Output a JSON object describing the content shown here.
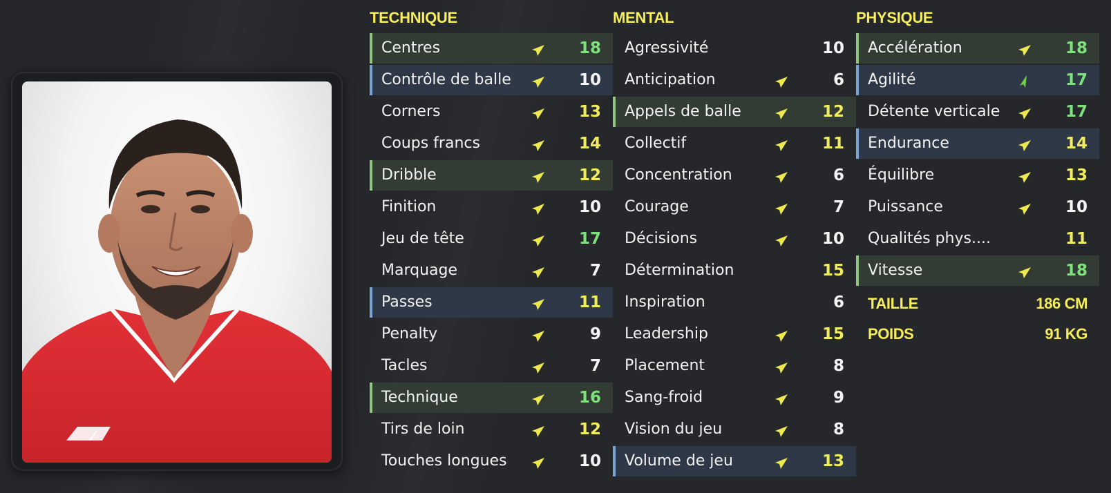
{
  "colors": {
    "background": "#25272b",
    "accent_yellow": "#f5ee5a",
    "value_green": "#7ee27c",
    "value_white": "#f4f4f4",
    "highlight_green": "#8ec77c",
    "highlight_blue": "#79a4da"
  },
  "columns": [
    {
      "title": "TECHNIQUE",
      "rows": [
        {
          "label": "Centres",
          "value": "18",
          "color": "green",
          "highlight": "green",
          "arrow": "yellow-up-right"
        },
        {
          "label": "Contrôle de balle",
          "value": "10",
          "color": "white",
          "highlight": "blue",
          "arrow": "yellow-up-right"
        },
        {
          "label": "Corners",
          "value": "13",
          "color": "yellow",
          "highlight": "none",
          "arrow": "yellow-up-right"
        },
        {
          "label": "Coups francs",
          "value": "14",
          "color": "yellow",
          "highlight": "none",
          "arrow": "yellow-up-right"
        },
        {
          "label": "Dribble",
          "value": "12",
          "color": "yellow",
          "highlight": "green",
          "arrow": "yellow-up-right"
        },
        {
          "label": "Finition",
          "value": "10",
          "color": "white",
          "highlight": "none",
          "arrow": "yellow-up-right"
        },
        {
          "label": "Jeu de tête",
          "value": "17",
          "color": "green",
          "highlight": "none",
          "arrow": "yellow-up-right"
        },
        {
          "label": "Marquage",
          "value": "7",
          "color": "white",
          "highlight": "none",
          "arrow": "yellow-up-right"
        },
        {
          "label": "Passes",
          "value": "11",
          "color": "yellow",
          "highlight": "blue",
          "arrow": "yellow-up-right"
        },
        {
          "label": "Penalty",
          "value": "9",
          "color": "white",
          "highlight": "none",
          "arrow": "yellow-up-right"
        },
        {
          "label": "Tacles",
          "value": "7",
          "color": "white",
          "highlight": "none",
          "arrow": "yellow-up-right"
        },
        {
          "label": "Technique",
          "value": "16",
          "color": "green",
          "highlight": "green",
          "arrow": "yellow-up-right"
        },
        {
          "label": "Tirs de loin",
          "value": "12",
          "color": "yellow",
          "highlight": "none",
          "arrow": "yellow-up-right"
        },
        {
          "label": "Touches longues",
          "value": "10",
          "color": "white",
          "highlight": "none",
          "arrow": "yellow-up-right"
        }
      ]
    },
    {
      "title": "MENTAL",
      "rows": [
        {
          "label": "Agressivité",
          "value": "10",
          "color": "white",
          "highlight": "none",
          "arrow": "none"
        },
        {
          "label": "Anticipation",
          "value": "6",
          "color": "white",
          "highlight": "none",
          "arrow": "yellow-up-right"
        },
        {
          "label": "Appels de balle",
          "value": "12",
          "color": "yellow",
          "highlight": "green",
          "arrow": "yellow-up-right"
        },
        {
          "label": "Collectif",
          "value": "11",
          "color": "yellow",
          "highlight": "none",
          "arrow": "yellow-up-right"
        },
        {
          "label": "Concentration",
          "value": "6",
          "color": "white",
          "highlight": "none",
          "arrow": "yellow-up-right"
        },
        {
          "label": "Courage",
          "value": "7",
          "color": "white",
          "highlight": "none",
          "arrow": "yellow-up-right"
        },
        {
          "label": "Décisions",
          "value": "10",
          "color": "white",
          "highlight": "none",
          "arrow": "yellow-up-right"
        },
        {
          "label": "Détermination",
          "value": "15",
          "color": "yellow",
          "highlight": "none",
          "arrow": "none"
        },
        {
          "label": "Inspiration",
          "value": "6",
          "color": "white",
          "highlight": "none",
          "arrow": "none"
        },
        {
          "label": "Leadership",
          "value": "15",
          "color": "yellow",
          "highlight": "none",
          "arrow": "yellow-up-right"
        },
        {
          "label": "Placement",
          "value": "8",
          "color": "white",
          "highlight": "none",
          "arrow": "yellow-up-right"
        },
        {
          "label": "Sang-froid",
          "value": "9",
          "color": "white",
          "highlight": "none",
          "arrow": "yellow-up-right"
        },
        {
          "label": "Vision du jeu",
          "value": "8",
          "color": "white",
          "highlight": "none",
          "arrow": "yellow-up-right"
        },
        {
          "label": "Volume de jeu",
          "value": "13",
          "color": "yellow",
          "highlight": "blue",
          "arrow": "yellow-up-right"
        }
      ]
    },
    {
      "title": "PHYSIQUE",
      "rows": [
        {
          "label": "Accélération",
          "value": "18",
          "color": "green",
          "highlight": "green",
          "arrow": "yellow-up-right"
        },
        {
          "label": "Agilité",
          "value": "17",
          "color": "green",
          "highlight": "blue",
          "arrow": "green-up"
        },
        {
          "label": "Détente verticale",
          "value": "17",
          "color": "green",
          "highlight": "none",
          "arrow": "yellow-up-right"
        },
        {
          "label": "Endurance",
          "value": "14",
          "color": "yellow",
          "highlight": "blue",
          "arrow": "yellow-up-right"
        },
        {
          "label": "Équilibre",
          "value": "13",
          "color": "yellow",
          "highlight": "none",
          "arrow": "yellow-up-right"
        },
        {
          "label": "Puissance",
          "value": "10",
          "color": "white",
          "highlight": "none",
          "arrow": "yellow-up-right"
        },
        {
          "label": "Qualités phys....",
          "value": "11",
          "color": "yellow",
          "highlight": "none",
          "arrow": "none"
        },
        {
          "label": "Vitesse",
          "value": "18",
          "color": "green",
          "highlight": "green",
          "arrow": "yellow-up-right"
        }
      ]
    }
  ],
  "info": [
    {
      "label": "TAILLE",
      "value": "186 CM"
    },
    {
      "label": "POIDS",
      "value": "91 KG"
    }
  ],
  "icons": {
    "yellow-up-right": "trend-arrow-icon",
    "green-up": "trend-arrow-up-icon"
  }
}
